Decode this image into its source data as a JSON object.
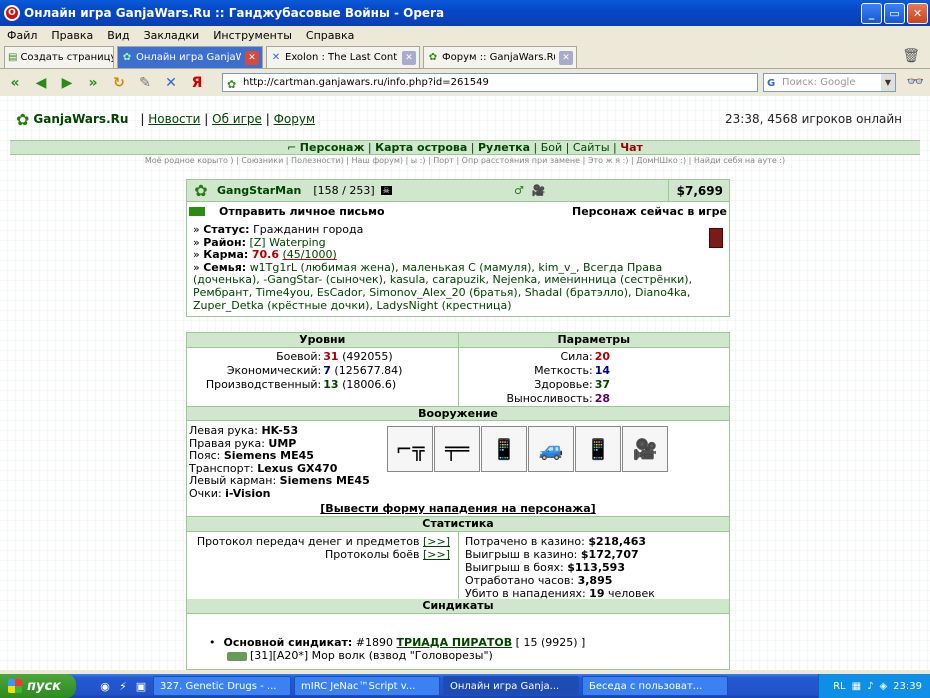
{
  "window": {
    "title": "Онлайн игра GanjaWars.Ru :: Ганджубасовые Войны - Opera"
  },
  "menu": [
    "Файл",
    "Правка",
    "Вид",
    "Закладки",
    "Инструменты",
    "Справка"
  ],
  "tabs": [
    {
      "label": "Создать страницу",
      "active": false
    },
    {
      "label": "Онлайн игра GanjaWars...",
      "active": true
    },
    {
      "label": "Exolon : The Last Contin...",
      "active": false
    },
    {
      "label": "Форум :: GanjaWars.Ru ...",
      "active": false
    }
  ],
  "address": {
    "url": "http://cartman.ganjawars.ru/info.php?id=261549"
  },
  "search": {
    "placeholder": "Поиск: Google"
  },
  "site": {
    "logo": "GanjaWars.Ru",
    "links": [
      "Новости",
      "Об игре",
      "Форум"
    ],
    "online": "23:38, 4568 игроков онлайн",
    "nav": [
      "Персонаж",
      "Карта острова",
      "Рулетка",
      "Бой",
      "Сайты",
      "Чат"
    ],
    "subnav": "Моё родное корыто ) | Союзники | Полезности) | Наш форум) | ы :) | Порт | Опр расстояния при замене | Это ж я :) | ДомНШко :) | Найди себя на ауте :)"
  },
  "profile": {
    "name": "GangStarMan",
    "level": "[158 / 253]",
    "money": "$7,699",
    "send_mail": "Отправить личное письмо",
    "online_state": "Персонаж сейчас в игре",
    "status_label": "Статус:",
    "status": "Гражданин города",
    "district_label": "Район:",
    "district": "[Z] Waterping",
    "karma_label": "Карма:",
    "karma": "70.6",
    "karma_extra": "(45/1000)",
    "family_label": "Семья:",
    "family": "w1Tg1rL (любимая жена), маленькая С (мамуля), kim_v_, Всегда Права (доченька), -GangStar- (сыночек), kasula, carapuzik, Nejenka, именинница (сестрёнки), Рембрант, Time4you, EsCador, Simonov_Alex_20 (братья), Shadal (братэлло), Diano4ka, Zuper_Detka (крёстные дочки), LadysNight (крестница)"
  },
  "levels": {
    "title": "Уровни",
    "rows": [
      {
        "label": "Боевой:",
        "value": "31",
        "extra": "(492055)"
      },
      {
        "label": "Экономический:",
        "value": "7",
        "extra": "(125677.84)"
      },
      {
        "label": "Производственный:",
        "value": "13",
        "extra": "(18006.6)"
      }
    ]
  },
  "params": {
    "title": "Параметры",
    "rows": [
      {
        "label": "Сила:",
        "value": "20"
      },
      {
        "label": "Меткость:",
        "value": "14"
      },
      {
        "label": "Здоровье:",
        "value": "37"
      },
      {
        "label": "Выносливость:",
        "value": "28"
      }
    ]
  },
  "arms": {
    "title": "Вооружение",
    "rows": [
      {
        "label": "Левая рука:",
        "value": "HK-53"
      },
      {
        "label": "Правая рука:",
        "value": "UMP"
      },
      {
        "label": "Пояс:",
        "value": "Siemens ME45"
      },
      {
        "label": "Транспорт:",
        "value": "Lexus GX470"
      },
      {
        "label": "Левый карман:",
        "value": "Siemens ME45"
      },
      {
        "label": "Очки:",
        "value": "i-Vision"
      }
    ],
    "icons": [
      "rifle-icon",
      "smg-icon",
      "phone-icon",
      "car-icon",
      "phone-icon",
      "goggles-icon"
    ]
  },
  "attack_link": "[Вывести форму нападения на персонажа]",
  "stats": {
    "title": "Статистика",
    "left": [
      {
        "label": "Протокол передач денег и предметов",
        "link": "[>>]"
      },
      {
        "label": "Протоколы боёв",
        "link": "[>>]"
      }
    ],
    "right": [
      {
        "label": "Потрачено в казино:",
        "value": "$218,463"
      },
      {
        "label": "Выигрыш в казино:",
        "value": "$172,707"
      },
      {
        "label": "Выигрыш в боях:",
        "value": "$113,593"
      },
      {
        "label": "Отработано часов:",
        "value": "3,895"
      },
      {
        "label": "Убито в нападениях:",
        "value": "19",
        "suffix": "человек"
      }
    ]
  },
  "syndicates": {
    "title": "Синдикаты",
    "main_label": "Основной синдикат:",
    "main_num": "#1890",
    "main_name": "ТРИАДА ПИРАТОВ",
    "main_extra": "[ 15 (9925) ]",
    "sub": "[31][A20*] Мор волк (взвод \"Головорезы\")"
  },
  "taskbar": {
    "start": "пуск",
    "tasks": [
      {
        "label": "327. Genetic Drugs - ...",
        "active": false
      },
      {
        "label": "mIRC JeNac™Script v...",
        "active": false
      },
      {
        "label": "Онлайн игра Ganja...",
        "active": true
      },
      {
        "label": "Беседа с пользоват...",
        "active": false
      }
    ],
    "lang": "RL",
    "clock": "23:39"
  }
}
